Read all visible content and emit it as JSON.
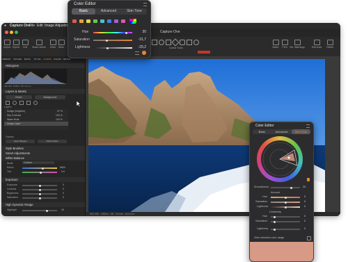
{
  "menubar": {
    "apple": "",
    "app_name": "Capture One",
    "items": [
      "File",
      "Edit",
      "Image",
      "Adjustments"
    ]
  },
  "window": {
    "title": "Capture One",
    "tool_tabs_label": "Cursor Tools"
  },
  "toolbar": {
    "left_buttons": [
      "Import",
      "Export",
      "Cull",
      "Share online",
      "Undo",
      "Redo",
      "Auto adjust"
    ],
    "right_buttons": [
      "Batch",
      "Print",
      "Sel. Warnings",
      "Edit tools",
      "Viewer"
    ]
  },
  "left_panel": {
    "tabs": [
      "LIBRARY",
      "TETHER",
      "BASIC",
      "STYLE",
      "LAYERS",
      "COLOR",
      "DETAIL"
    ],
    "histogram": "Histogram",
    "histogram_info": [
      "ISO 200",
      "1/500 s",
      "f/8",
      "24 mm"
    ],
    "layers_masks": "Layers & Masks",
    "layer_buttons": [
      "Brush",
      "Background"
    ],
    "layers_label": "Layers",
    "layers": [
      {
        "name": "Dodge (brighten)",
        "value": "37 %"
      },
      {
        "name": "Sky Contrast",
        "value": "100 %"
      },
      {
        "name": "Warm Boat",
        "value": "100 %"
      },
      {
        "name": "Image Layer",
        "value": ""
      }
    ],
    "opacity_label": "Opacity",
    "layer_actions": [
      "Clear Ranges",
      "Refine Mask"
    ],
    "style_brushes": "Style Brushes",
    "smart_adjustments": "Smart Adjustments",
    "white_balance": "White Balance",
    "wb_rows": [
      {
        "label": "Mode",
        "value": "Custom"
      },
      {
        "label": "Kelvin",
        "value": "5604"
      },
      {
        "label": "Tint",
        "value": "0.6"
      }
    ],
    "exposure": "Exposure",
    "exposure_rows": [
      {
        "label": "Exposure",
        "value": "0"
      },
      {
        "label": "Contrast",
        "value": "0"
      },
      {
        "label": "Brightness",
        "value": "0"
      },
      {
        "label": "Saturation",
        "value": "0"
      }
    ],
    "hdr": "High Dynamic Range",
    "hdr_rows": [
      {
        "label": "Highlight",
        "value": "43"
      }
    ]
  },
  "status_bar": {
    "items": [
      "ISO 200",
      "1/500 s",
      "f/8",
      "24 mm",
      "44.5 mm"
    ]
  },
  "color_editor_top": {
    "title": "Color Editor",
    "tabs": [
      "Basic",
      "Advanced",
      "Skin Tone"
    ],
    "active_tab": "Basic",
    "swatches": [
      "#e05a4a",
      "#e8a23c",
      "#e5d84a",
      "#6bc452",
      "#4cc3c8",
      "#4d7fe0",
      "#a060d8",
      "#d85aa8"
    ],
    "hue_label": "Hue",
    "hue_value": "30",
    "saturation_label": "Saturation",
    "saturation_value": "-31,7",
    "lightness_label": "Lightness",
    "lightness_value": "-29,2",
    "hue_level": 0.85,
    "saturation_level": 0.35,
    "lightness_level": 0.36
  },
  "color_editor_right": {
    "title": "Color Editor",
    "tabs": [
      "Basic",
      "Advanced",
      "Skin Tone"
    ],
    "active_tab": "Skin Tone",
    "smoothness_label": "Smoothness",
    "smoothness_value": "20",
    "amount_header": "Amount",
    "amount_rows": [
      {
        "label": "Hue",
        "value": "0"
      },
      {
        "label": "Saturation",
        "value": "0"
      },
      {
        "label": "Lightness",
        "value": "0"
      }
    ],
    "uniformity_header": "Uniformity",
    "uniformity_rows": [
      {
        "label": "Hue",
        "value": "0"
      },
      {
        "label": "Saturation",
        "value": "0"
      },
      {
        "label": "Lightness",
        "value": "0"
      }
    ],
    "view_selected_label": "View selected color range",
    "skin_swatch_color": "#d89a86"
  },
  "colors": {
    "accent_orange": "#e8862e",
    "traffic_red": "#ff5f57",
    "traffic_yellow": "#febc2e",
    "traffic_green": "#28c840"
  }
}
